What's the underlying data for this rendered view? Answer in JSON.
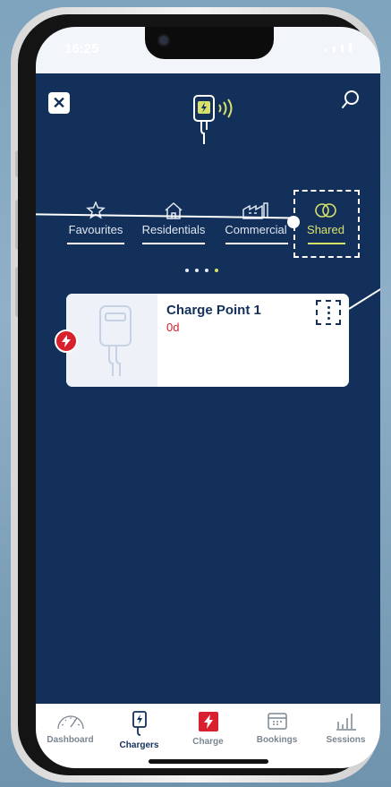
{
  "status": {
    "time": "16:25"
  },
  "header": {
    "close_icon": "close-icon",
    "logo_icon": "charger-wireless-logo-icon",
    "search_icon": "search-icon"
  },
  "tabs": [
    {
      "label": "Favourites",
      "icon": "star-icon",
      "active": false
    },
    {
      "label": "Residentials",
      "icon": "house-icon",
      "active": false
    },
    {
      "label": "Commercial",
      "icon": "factory-icon",
      "active": false
    },
    {
      "label": "Shared",
      "icon": "linked-rings-icon",
      "active": true
    }
  ],
  "pager": {
    "count": 4,
    "active_index": 3
  },
  "charger_card": {
    "title": "Charge Point 1",
    "subtitle": "0d",
    "status_icon": "lightning-icon",
    "menu_icon": "kebab-menu-icon"
  },
  "bottom_nav": [
    {
      "label": "Dashboard",
      "icon": "speedometer-icon",
      "active": false
    },
    {
      "label": "Chargers",
      "icon": "charger-icon",
      "active": true
    },
    {
      "label": "Charge",
      "icon": "lightning-icon",
      "active": false
    },
    {
      "label": "Bookings",
      "icon": "calendar-icon",
      "active": false
    },
    {
      "label": "Sessions",
      "icon": "bar-chart-icon",
      "active": false
    }
  ],
  "colors": {
    "navy": "#13305b",
    "accent": "#d7e16a",
    "red": "#d8212c",
    "white": "#ffffff"
  }
}
